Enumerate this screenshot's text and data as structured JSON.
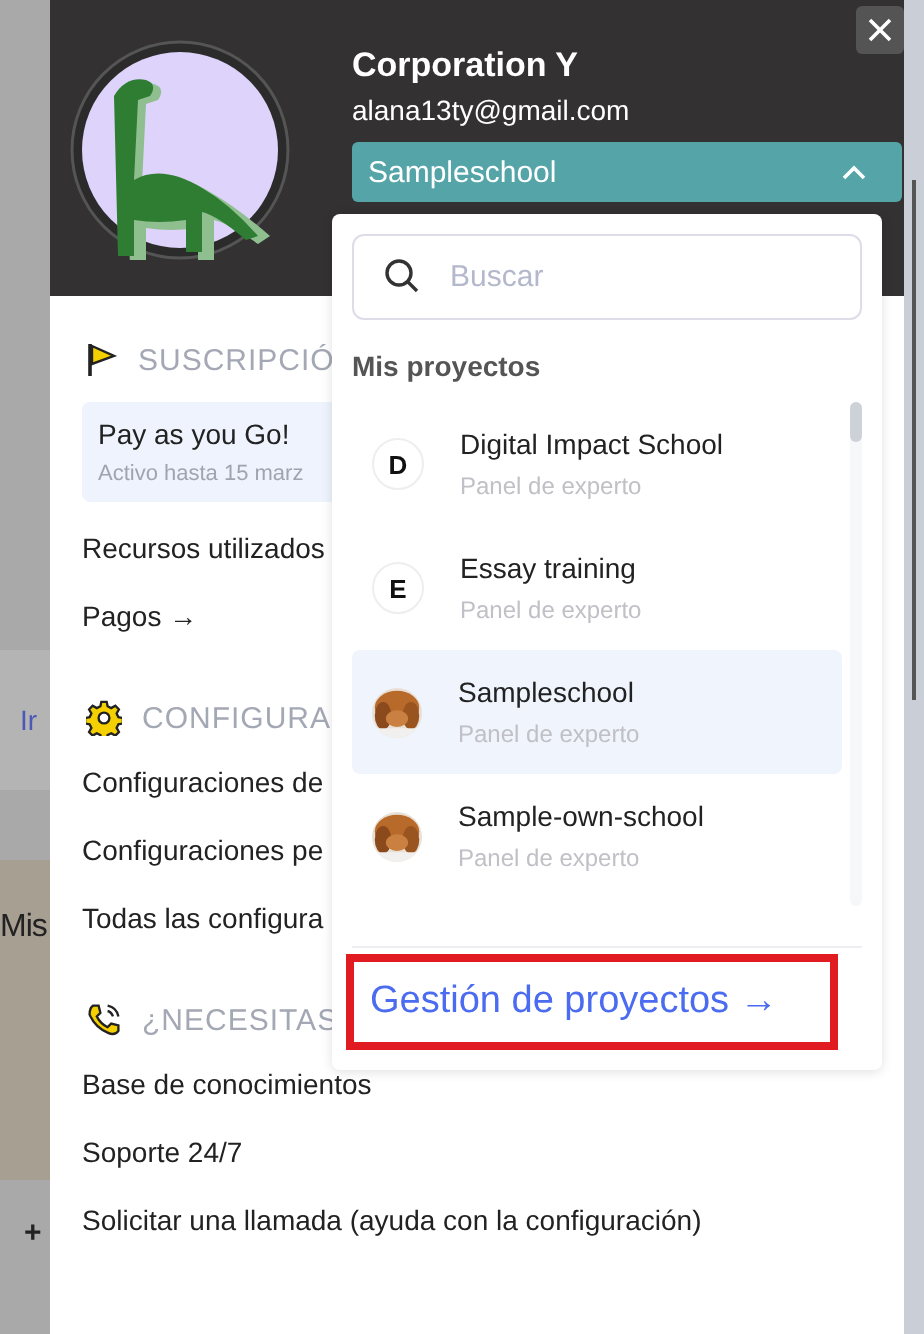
{
  "background_page": {
    "link": "Ir",
    "heading": "Mis",
    "add": "+"
  },
  "profile": {
    "name": "Corporation Y",
    "email": "alana13ty@gmail.com",
    "project_select": {
      "value": "Sampleschool",
      "expanded": true
    }
  },
  "sections": [
    {
      "kind": "subscription",
      "title": "SUSCRIPCIÓ",
      "plan": {
        "name": "Pay as you Go!",
        "detail": "Activo hasta 15 marz"
      },
      "links": [
        "Recursos utilizados",
        "Pagos →"
      ]
    },
    {
      "kind": "settings",
      "title": "CONFIGURA",
      "links": [
        "Configuraciones de",
        "Configuraciones pe",
        "Todas las configura"
      ]
    },
    {
      "kind": "help",
      "title": "¿NECESITAS",
      "links": [
        "Base de conocimientos",
        "Soporte 24/7",
        "Solicitar una llamada (ayuda con la configuración)"
      ]
    }
  ],
  "project_menu": {
    "search": {
      "placeholder": "Buscar"
    },
    "heading": "Mis proyectos",
    "projects": [
      {
        "kind": "letter",
        "letter": "D",
        "name": "Digital Impact School",
        "role": "Panel de experto",
        "selected": false
      },
      {
        "kind": "letter",
        "letter": "E",
        "name": "Essay training",
        "role": "Panel de experto",
        "selected": false
      },
      {
        "kind": "picture",
        "name": "Sampleschool",
        "role": "Panel de experto",
        "selected": true
      },
      {
        "kind": "picture",
        "name": "Sample-own-school",
        "role": "Panel de experto",
        "selected": false
      }
    ],
    "footer_link": {
      "label": "Gestión de proyectos →",
      "highlighted": true
    }
  }
}
